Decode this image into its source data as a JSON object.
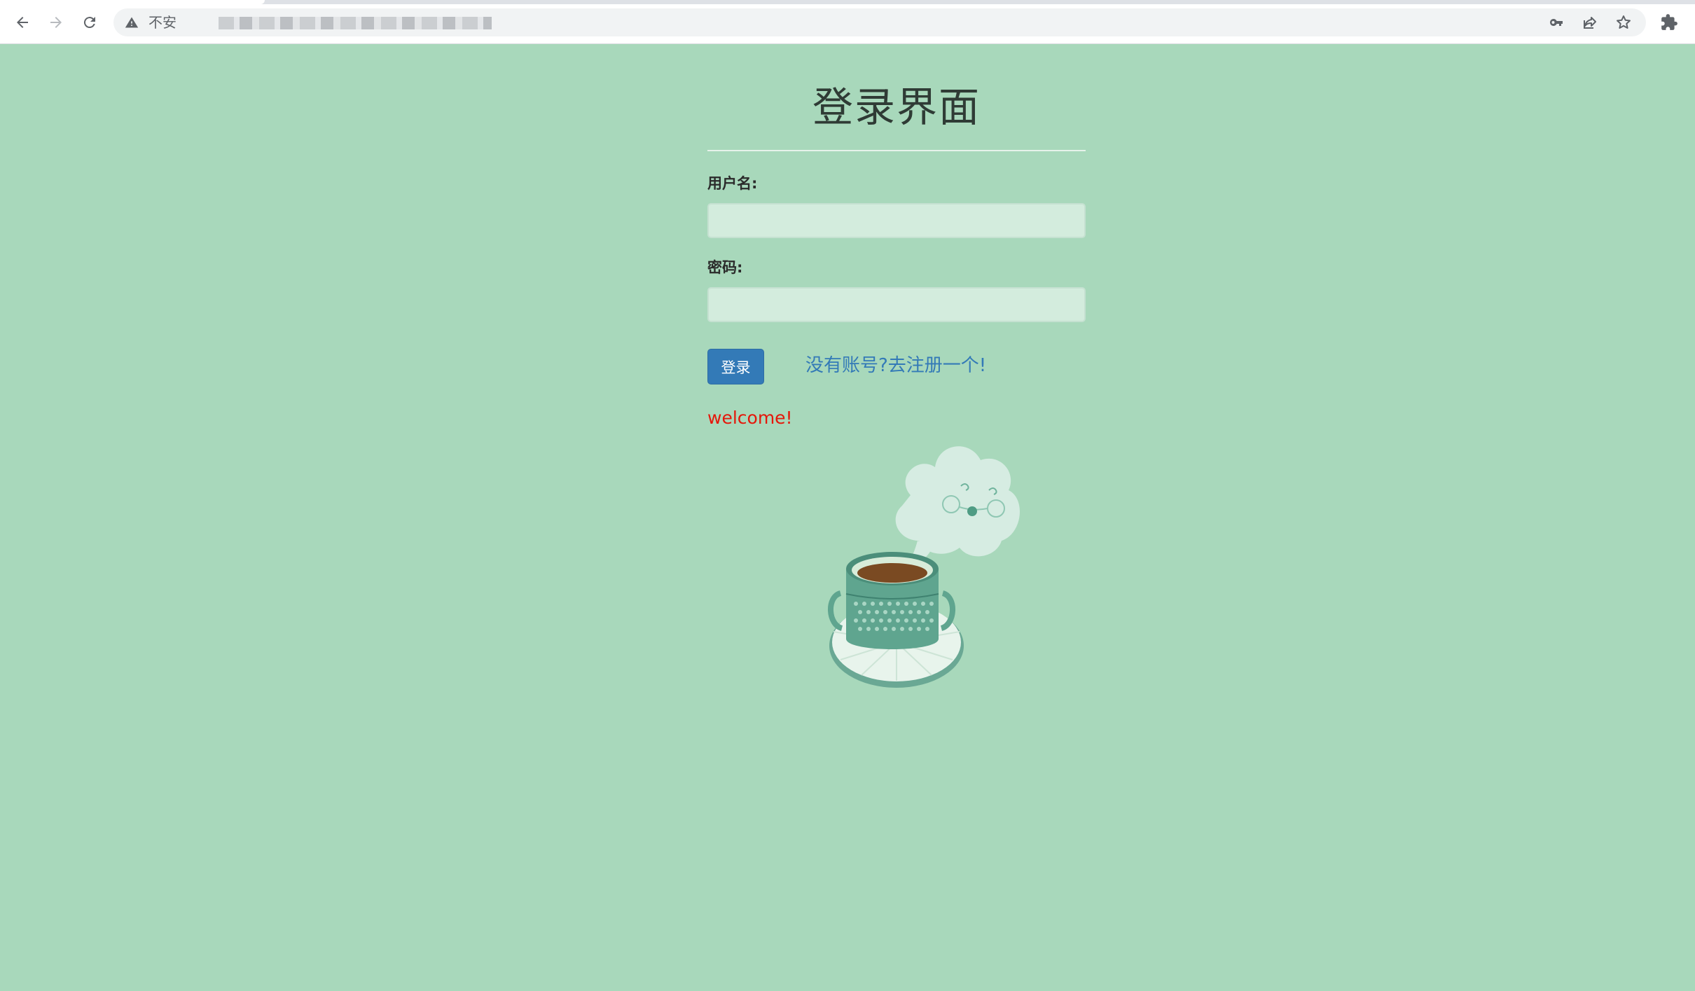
{
  "browser": {
    "security_label": "不安",
    "icons": {
      "back": "back-arrow-icon",
      "forward": "forward-arrow-icon",
      "reload": "reload-icon",
      "warning": "warning-triangle-icon",
      "key": "key-icon",
      "share": "share-icon",
      "bookmark": "star-icon",
      "extensions": "puzzle-icon"
    }
  },
  "page": {
    "title": "登录界面",
    "username_label": "用户名:",
    "username_value": "",
    "password_label": "密码:",
    "password_value": "",
    "login_button": "登录",
    "register_link": "没有账号?去注册一个!",
    "welcome_message": "welcome!"
  },
  "colors": {
    "background": "#a8d8bb",
    "primary": "#337ab7",
    "welcome": "#e5170a"
  },
  "illustration": "coffee-cup-with-steam-cloud"
}
